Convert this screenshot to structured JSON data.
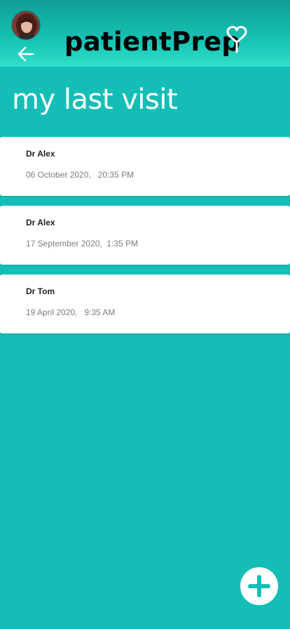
{
  "header": {
    "brand": "patientPrep"
  },
  "page": {
    "title": "my last visit"
  },
  "visits": [
    {
      "doctor": "Dr Alex",
      "date": "06 October 2020,   20:35 PM"
    },
    {
      "doctor": "Dr Alex",
      "date": "17 September 2020,  1:35 PM"
    },
    {
      "doctor": "Dr Tom",
      "date": "19 April 2020,   9:35 AM"
    }
  ],
  "icons": {
    "back": "arrow-left-icon",
    "logo": "heart-stem-logo",
    "add": "plus-icon"
  },
  "colors": {
    "background": "#14beb6",
    "header_top": "#0f9e96",
    "header_bottom": "#2ee0c9",
    "card": "#ffffff",
    "accent": "#14beb6"
  }
}
